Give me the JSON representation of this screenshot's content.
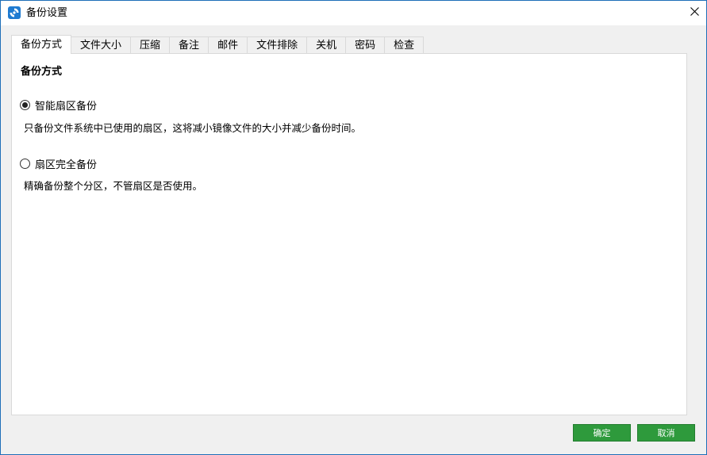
{
  "window": {
    "title": "备份设置",
    "close_glyph": "✕"
  },
  "tabs": [
    {
      "label": "备份方式",
      "active": true
    },
    {
      "label": "文件大小",
      "active": false
    },
    {
      "label": "压缩",
      "active": false
    },
    {
      "label": "备注",
      "active": false
    },
    {
      "label": "邮件",
      "active": false
    },
    {
      "label": "文件排除",
      "active": false
    },
    {
      "label": "关机",
      "active": false
    },
    {
      "label": "密码",
      "active": false
    },
    {
      "label": "检查",
      "active": false
    }
  ],
  "panel": {
    "section_title": "备份方式",
    "options": [
      {
        "label": "智能扇区备份",
        "selected": true,
        "description": "只备份文件系统中已使用的扇区，这将减小镜像文件的大小并减少备份时间。"
      },
      {
        "label": "扇区完全备份",
        "selected": false,
        "description": "精确备份整个分区，不管扇区是否使用。"
      }
    ]
  },
  "buttons": {
    "ok_label": "确定",
    "cancel_label": "取消"
  },
  "colors": {
    "button_green": "#2e9a3c",
    "window_border": "#1e6fb8",
    "icon_blue": "#1f7bd1"
  },
  "icons": {
    "app": "app-icon",
    "close": "close-icon"
  }
}
